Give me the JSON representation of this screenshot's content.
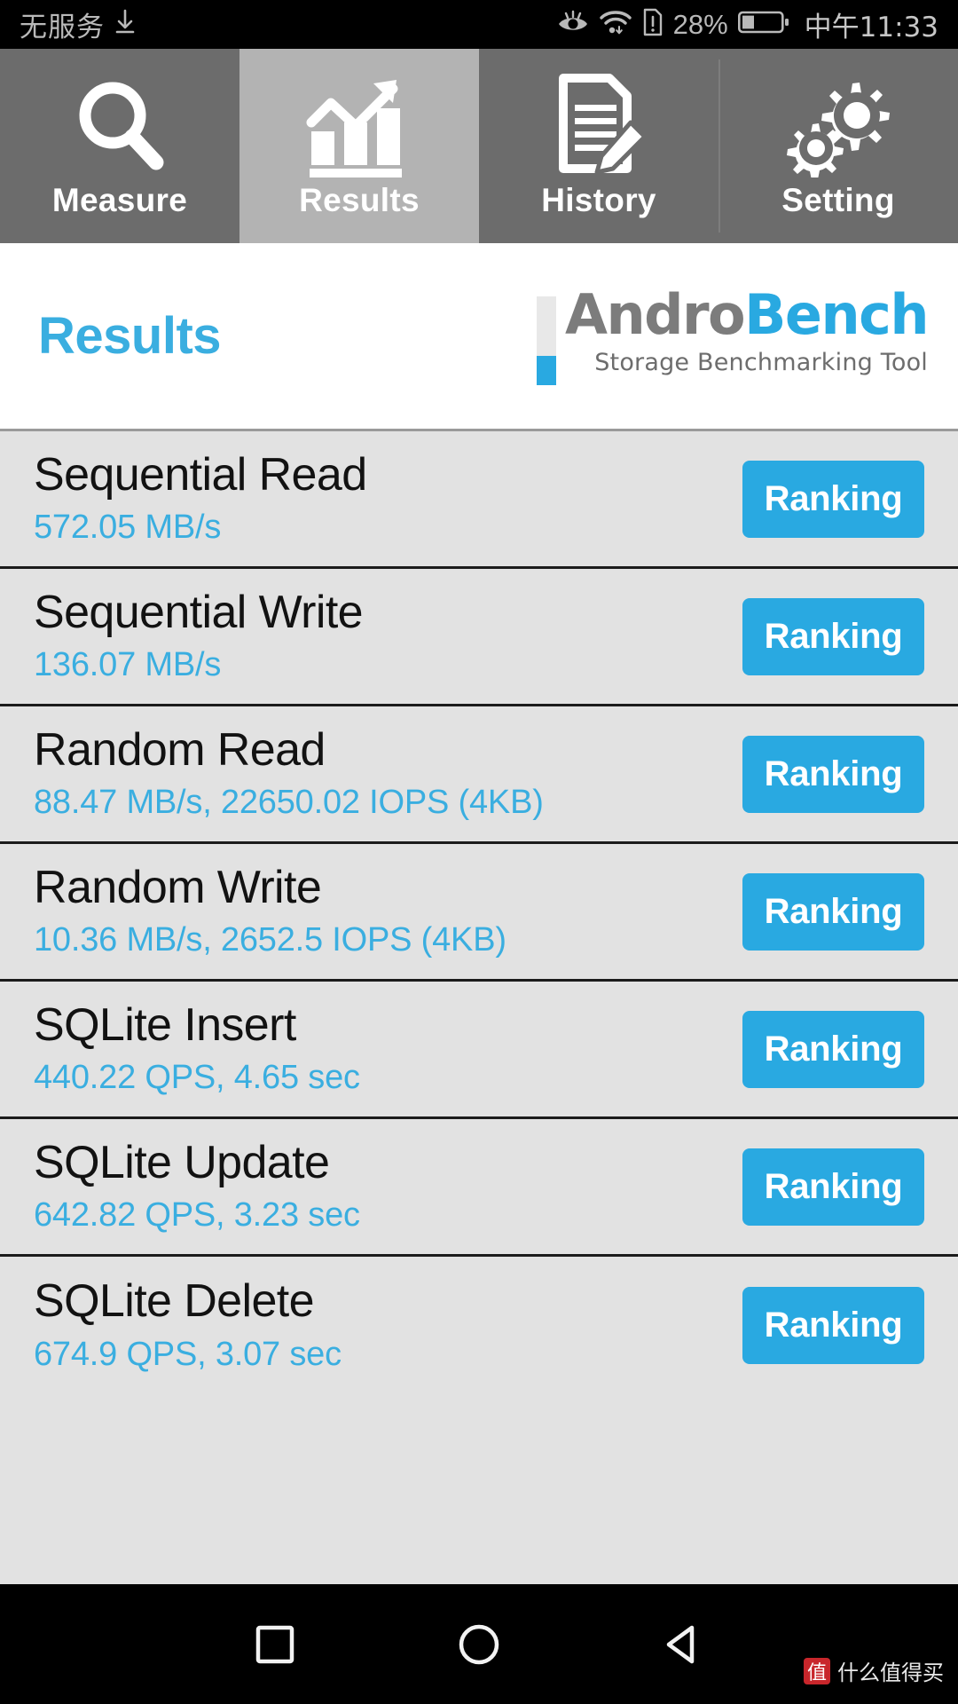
{
  "status_bar": {
    "carrier": "无服务",
    "download_icon": "download-arrow-icon",
    "eye_comfort_icon": "eye-comfort-icon",
    "wifi_icon": "wifi-icon",
    "sim_alert_icon": "sim-card-alert-icon",
    "battery_percent": "28%",
    "battery_icon": "battery-icon",
    "clock": "中午11:33"
  },
  "tabs": [
    {
      "label": "Measure",
      "icon": "magnifier-icon",
      "active": false
    },
    {
      "label": "Results",
      "icon": "bar-chart-growth-icon",
      "active": true
    },
    {
      "label": "History",
      "icon": "document-pencil-icon",
      "active": false
    },
    {
      "label": "Setting",
      "icon": "gears-icon",
      "active": false
    }
  ],
  "header": {
    "title": "Results",
    "logo_primary": "Andro",
    "logo_secondary": "Bench",
    "logo_tagline": "Storage Benchmarking Tool"
  },
  "results": {
    "button_label": "Ranking",
    "rows": [
      {
        "name": "Sequential Read",
        "value": "572.05 MB/s"
      },
      {
        "name": "Sequential Write",
        "value": "136.07 MB/s"
      },
      {
        "name": "Random Read",
        "value": "88.47 MB/s, 22650.02 IOPS (4KB)"
      },
      {
        "name": "Random Write",
        "value": "10.36 MB/s, 2652.5 IOPS (4KB)"
      },
      {
        "name": "SQLite Insert",
        "value": "440.22 QPS, 4.65 sec"
      },
      {
        "name": "SQLite Update",
        "value": "642.82 QPS, 3.23 sec"
      },
      {
        "name": "SQLite Delete",
        "value": "674.9 QPS, 3.07 sec"
      }
    ]
  },
  "nav_bar": {
    "recents_icon": "square-recents-icon",
    "home_icon": "circle-home-icon",
    "back_icon": "triangle-back-icon",
    "watermark_badge": "值",
    "watermark_text": "什么值得买"
  },
  "colors": {
    "accent_blue": "#29a9e1",
    "title_blue": "#3aaee0",
    "tab_inactive": "#6c6c6c",
    "tab_active": "#b3b3b3",
    "list_bg": "#e2e2e2"
  }
}
